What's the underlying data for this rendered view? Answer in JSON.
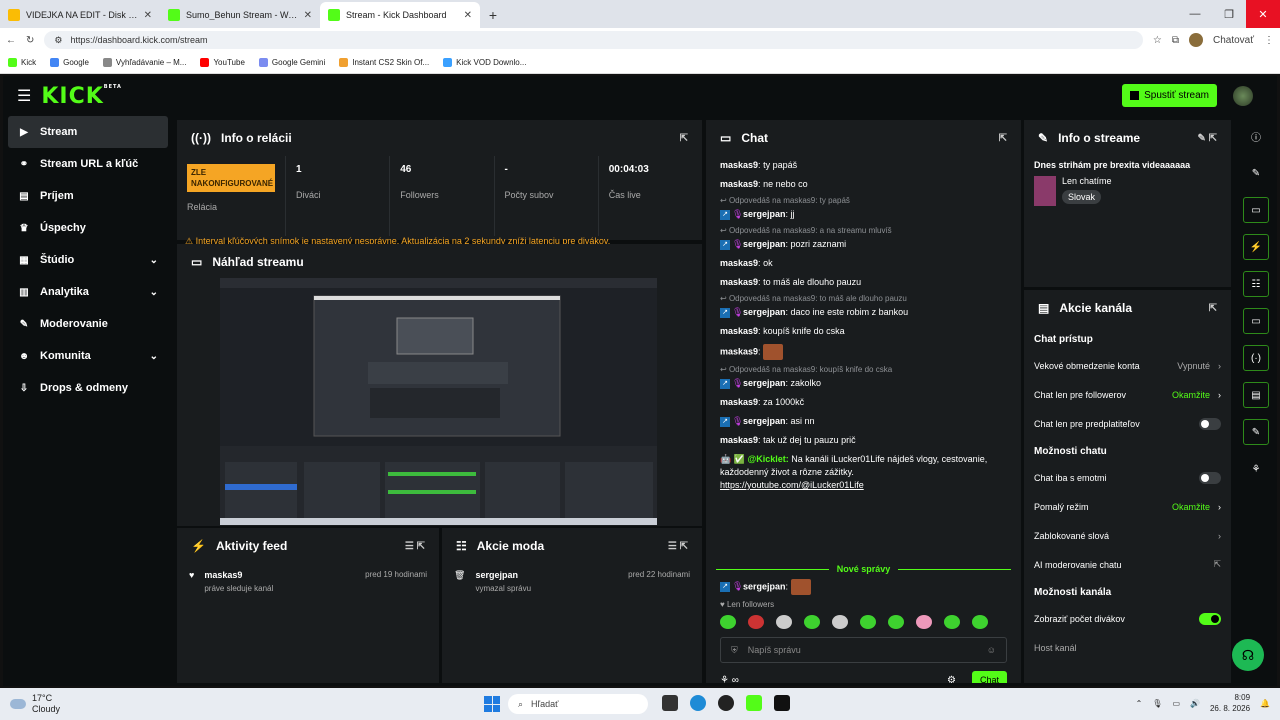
{
  "browser": {
    "tabs": [
      {
        "label": "VIDEJKA NA EDIT - Disk Google",
        "color": "#fbbc04"
      },
      {
        "label": "Sumo_Behun Stream - Watch",
        "color": "#53fc18"
      },
      {
        "label": "Stream - Kick Dashboard",
        "color": "#53fc18"
      }
    ],
    "url": "https://dashboard.kick.com/stream",
    "profile": "Chatovať",
    "bookmarks": [
      "Kick",
      "Google",
      "Vyhľadávanie – M...",
      "YouTube",
      "Google Gemini",
      "Instant CS2 Skin Of...",
      "Kick VOD Downlo..."
    ]
  },
  "header": {
    "logo": "KICK",
    "beta": "BETA",
    "start_stream": "Spustiť stream"
  },
  "sidebar": {
    "items": [
      {
        "label": "Stream",
        "icon": "stream-icon",
        "glyph": "▶"
      },
      {
        "label": "Stream URL a kľúč",
        "icon": "link-icon",
        "glyph": "⚭"
      },
      {
        "label": "Príjem",
        "icon": "chart-icon",
        "glyph": "▤"
      },
      {
        "label": "Úspechy",
        "icon": "trophy-icon",
        "glyph": "♛"
      },
      {
        "label": "Štúdio",
        "icon": "studio-icon",
        "glyph": "▦"
      },
      {
        "label": "Analytika",
        "icon": "analytics-icon",
        "glyph": "▥"
      },
      {
        "label": "Moderovanie",
        "icon": "wrench-icon",
        "glyph": "✎"
      },
      {
        "label": "Komunita",
        "icon": "community-icon",
        "glyph": "☻"
      },
      {
        "label": "Drops & odmeny",
        "icon": "drops-icon",
        "glyph": "⇩"
      }
    ]
  },
  "session": {
    "title": "Info o relácii",
    "badge": "ZLE NAKONFIGUROVANÉ",
    "badge_label": "Relácia",
    "viewers": "1",
    "viewers_label": "Diváci",
    "followers": "46",
    "followers_label": "Followers",
    "subs": "-",
    "subs_label": "Počty subov",
    "live_time": "00:04:03",
    "live_label": "Čas live",
    "warning": "Interval kľúčových snímok je nastavený nesprávne. Aktualizácia na 2 sekundy zníži latenciu pre divákov."
  },
  "preview": {
    "title": "Náhľad streamu"
  },
  "activity": {
    "title": "Aktivity feed",
    "items": [
      {
        "user": "maskas9",
        "text": "práve sleduje kanál",
        "time": "pred 19 hodinami"
      }
    ]
  },
  "modactions": {
    "title": "Akcie moda",
    "items": [
      {
        "user": "sergejpan",
        "text": "vymazal správu",
        "time": "pred 22 hodinami"
      }
    ]
  },
  "chat": {
    "title": "Chat",
    "messages": [
      {
        "user": "maskas9",
        "text": "ty papáš"
      },
      {
        "user": "maskas9",
        "text": "ne nebo co"
      },
      {
        "reply": "Odpovedáš na maskas9: ty papáš",
        "user": "sergejpan",
        "text": "jj",
        "badges": true
      },
      {
        "reply": "Odpovedáš na maskas9: a na streamu mluvíš",
        "user": "sergejpan",
        "text": "pozri zaznami",
        "badges": true
      },
      {
        "user": "maskas9",
        "text": "ok"
      },
      {
        "user": "maskas9",
        "text": "to máš ale dlouho pauzu"
      },
      {
        "reply": "Odpovedáš na maskas9: to máš ale dlouho pauzu",
        "user": "sergejpan",
        "text": "daco ine este robim z bankou",
        "badges": true
      },
      {
        "user": "maskas9",
        "text": "koupíš knife do cska"
      },
      {
        "user": "maskas9",
        "text": "",
        "emote": true
      },
      {
        "reply": "Odpovedáš na maskas9: koupíš knife do cska",
        "user": "sergejpan",
        "text": "zakolko",
        "badges": true
      },
      {
        "user": "maskas9",
        "text": "za 1000kč"
      },
      {
        "user": "sergejpan",
        "text": "asi nn",
        "badges": true
      },
      {
        "user": "maskas9",
        "text": "tak už dej tu pauzu prič"
      }
    ],
    "bot": {
      "user": "@Kicklet:",
      "text": "Na kanáli iLucker01Life nájdeš vlogy, cestovanie, každodenný život a rôzne zážitky.",
      "link": "https://youtube.com/@iLucker01Life"
    },
    "new_messages": "Nové správy",
    "last": {
      "user": "sergejpan"
    },
    "followers_only": "Len followers",
    "placeholder": "Napíš správu",
    "send": "Chat"
  },
  "streaminfo": {
    "title": "Info o streame",
    "stream_title": "Dnes strihám pre brexita videaaaaaa",
    "category": "Len chatíme",
    "tag": "Slovak"
  },
  "channel": {
    "title": "Akcie kanála",
    "sec1": "Chat prístup",
    "age": "Vekové obmedzenie konta",
    "age_val": "Vypnuté",
    "followers": "Chat len pre followerov",
    "followers_val": "Okamžite",
    "subs": "Chat len pre predplatiteľov",
    "sec2": "Možnosti chatu",
    "emotes": "Chat iba s emotmi",
    "slow": "Pomalý režim",
    "slow_val": "Okamžite",
    "blocked": "Zablokované slová",
    "ai": "AI moderovanie chatu",
    "sec3": "Možnosti kanála",
    "viewers": "Zobraziť počet divákov",
    "host": "Host kanál"
  },
  "taskbar": {
    "temp": "17°C",
    "weather": "Cloudy",
    "search": "Hľadať",
    "time": "8:09",
    "date": "26. 8. 2026"
  }
}
